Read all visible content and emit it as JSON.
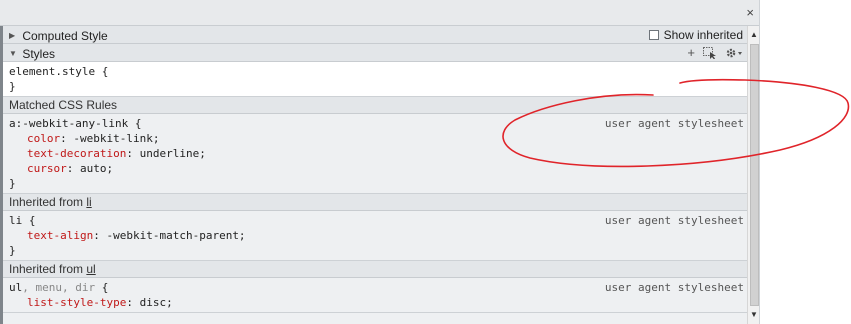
{
  "panel": {
    "close_label": "×"
  },
  "computed_style": {
    "label": "Computed Style",
    "show_inherited_label": "Show inherited"
  },
  "styles": {
    "label": "Styles",
    "tool_icons": [
      "add-rule-icon",
      "element-state-icon",
      "gear-icon"
    ]
  },
  "element_style": {
    "selector": "element.style {",
    "close": "}"
  },
  "matched": {
    "label": "Matched CSS Rules",
    "selector": "a:-webkit-any-link {",
    "origin": "user agent stylesheet",
    "props": [
      {
        "name": "color",
        "value": "-webkit-link;"
      },
      {
        "name": "text-decoration",
        "value": "underline;"
      },
      {
        "name": "cursor",
        "value": "auto;"
      }
    ],
    "close": "}"
  },
  "inherited_li": {
    "prefix": "Inherited from ",
    "link": "li",
    "selector": "li {",
    "origin": "user agent stylesheet",
    "props": [
      {
        "name": "text-align",
        "value": "-webkit-match-parent;"
      }
    ],
    "close": "}"
  },
  "inherited_ul": {
    "prefix": "Inherited from ",
    "link": "ul",
    "selector_main": "ul",
    "selector_rest": ", menu, dir",
    "selector_brace": " {",
    "origin": "user agent stylesheet",
    "props": [
      {
        "name": "list-style-type",
        "value": "disc;"
      }
    ]
  },
  "annotation_color": "#e0242a"
}
